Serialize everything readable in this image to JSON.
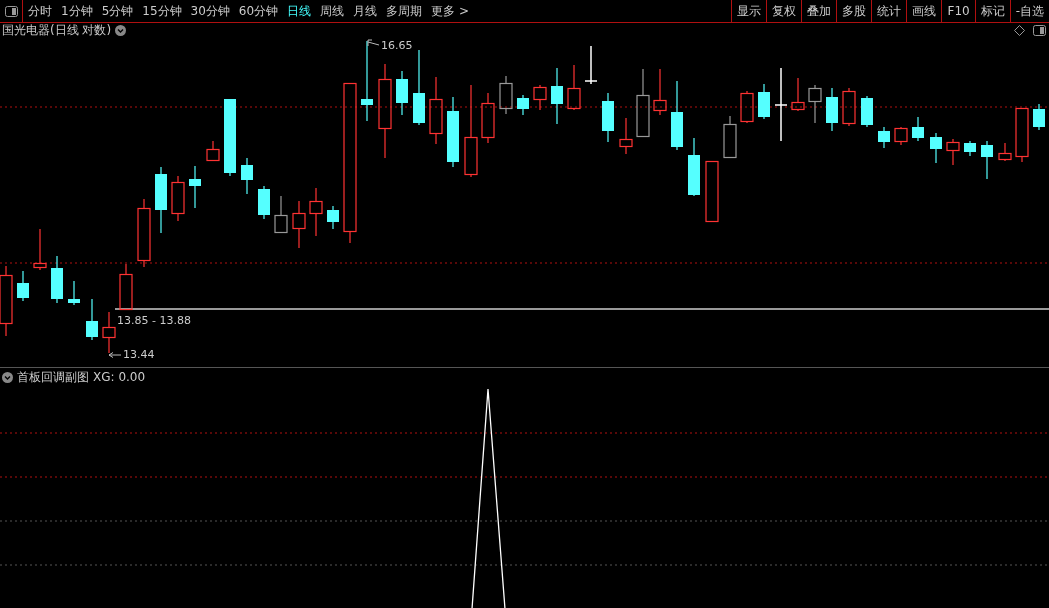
{
  "toolbar": {
    "periods": [
      {
        "label": "分时",
        "selected": false
      },
      {
        "label": "1分钟",
        "selected": false
      },
      {
        "label": "5分钟",
        "selected": false
      },
      {
        "label": "15分钟",
        "selected": false
      },
      {
        "label": "30分钟",
        "selected": false
      },
      {
        "label": "60分钟",
        "selected": false
      },
      {
        "label": "日线",
        "selected": true
      },
      {
        "label": "周线",
        "selected": false
      },
      {
        "label": "月线",
        "selected": false
      },
      {
        "label": "多周期",
        "selected": false
      },
      {
        "label": "更多 >",
        "selected": false
      }
    ],
    "buttons": [
      "显示",
      "复权",
      "叠加",
      "多股",
      "统计",
      "画线",
      "F10",
      "标记",
      "-自选"
    ]
  },
  "main_chart": {
    "title": "国光电器(日线 对数)",
    "high_label": "16.65",
    "range_label": "13.85 - 13.88",
    "low_label": "13.44"
  },
  "sub_chart": {
    "title": "首板回调副图",
    "value": "XG: 0.00"
  }
}
